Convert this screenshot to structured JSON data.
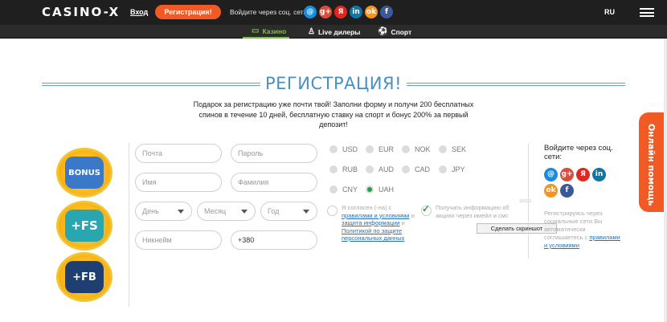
{
  "header": {
    "logo": "CASINO-X",
    "login": "Вход",
    "register": "Регистрация!",
    "social_label": "Войдите через соц. сети:",
    "social_icons": [
      {
        "name": "mail-ru-icon",
        "glyph": "@",
        "color": "#168de2"
      },
      {
        "name": "google-plus-icon",
        "glyph": "g+",
        "color": "#dd4b39"
      },
      {
        "name": "yandex-icon",
        "glyph": "Я",
        "color": "#e52620"
      },
      {
        "name": "linkedin-icon",
        "glyph": "in",
        "color": "#0e76a8"
      },
      {
        "name": "odnoklassniki-icon",
        "glyph": "ok",
        "color": "#f7931e"
      },
      {
        "name": "facebook-icon",
        "glyph": "f",
        "color": "#3b5998"
      }
    ],
    "language": "RU"
  },
  "subnav": {
    "tabs": [
      {
        "label": "Казино",
        "icon": "▭",
        "active": true
      },
      {
        "label": "Live дилеры",
        "icon": "♙",
        "active": false
      },
      {
        "label": "Спорт",
        "icon": "⚽",
        "active": false
      }
    ]
  },
  "registration": {
    "title": "РЕГИСТРАЦИЯ!",
    "intro": "Подарок за регистрацию уже почти твой! Заполни форму и получи 200 бесплатных спинов в течение 10 дней, бесплатную ставку на спорт и бонус 200% за первый депозит!",
    "promo": [
      "BONUS",
      "+FS",
      "+FB"
    ],
    "fields": {
      "email": "Почта",
      "password": "Пароль",
      "first_name": "Имя",
      "last_name": "Фамилия",
      "day": "День",
      "month": "Месяц",
      "year": "Год",
      "nickname": "Никнейм",
      "phone": "+380"
    },
    "currencies": [
      "USD",
      "EUR",
      "NOK",
      "SEK",
      "RUB",
      "AUD",
      "CAD",
      "JPY",
      "CNY",
      "UAH"
    ],
    "selected_currency": "UAH",
    "agree_prefix": "Я согласен (-на) с",
    "agree_link1": "правилами и условиями",
    "agree_mid": "и",
    "agree_link2": "защита информации",
    "agree_mid2": "и",
    "agree_link3": "Политикой по защите персональных данных",
    "newsletter": "Получать информацию об акциях через имейл и смс",
    "counter": "10/131",
    "tooltip": "Сделать скриншот"
  },
  "social_login": {
    "title": "Войдите через соц. сети:",
    "icons": [
      {
        "name": "mail-ru-icon",
        "glyph": "@",
        "color": "#168de2"
      },
      {
        "name": "google-plus-icon",
        "glyph": "g+",
        "color": "#dd4b39"
      },
      {
        "name": "yandex-icon",
        "glyph": "Я",
        "color": "#e52620"
      },
      {
        "name": "linkedin-icon",
        "glyph": "in",
        "color": "#0e76a8"
      },
      {
        "name": "odnoklassniki-icon",
        "glyph": "ok",
        "color": "#f7931e"
      },
      {
        "name": "facebook-icon",
        "glyph": "f",
        "color": "#3b5998"
      }
    ],
    "note": "Регистрируясь через социальные сети Вы автоматически соглашаетесь с",
    "note_link": "правилами и условиями"
  },
  "help_tab": "Онлайн помощь",
  "colors": {
    "accent": "#f15a24",
    "active_tab": "#7cc242",
    "heading": "#4a8fc1",
    "link": "#2a6fb0"
  }
}
